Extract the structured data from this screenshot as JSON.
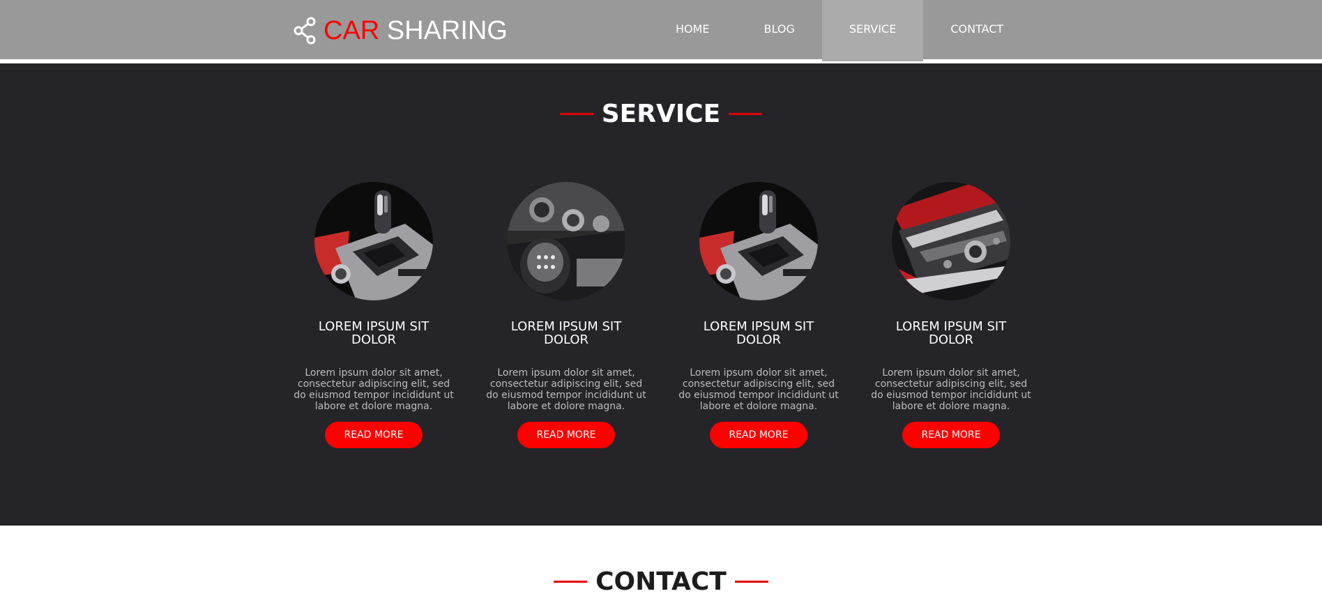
{
  "brand": {
    "logo_icon": "share-icon",
    "word_accent": "CAR",
    "word_main": "SHARING",
    "accent_color": "#ff0000"
  },
  "nav": {
    "items": [
      {
        "label": "HOME"
      },
      {
        "label": "BLOG"
      },
      {
        "label": "SERVICE",
        "active": true
      },
      {
        "label": "CONTACT"
      }
    ]
  },
  "service": {
    "title": "SERVICE",
    "cards": [
      {
        "image": "gear-shift-photo",
        "title": "LOREM IPSUM SIT DOLOR",
        "text": "Lorem ipsum dolor sit amet, consectetur adipiscing elit, sed do eiusmod tempor incididunt ut labore et dolore magna.",
        "button": "READ MORE"
      },
      {
        "image": "manual-gearstick-photo",
        "title": "LOREM IPSUM SIT DOLOR",
        "text": "Lorem ipsum dolor sit amet, consectetur adipiscing elit, sed do eiusmod tempor incididunt ut labore et dolore magna.",
        "button": "READ MORE"
      },
      {
        "image": "gear-shift-photo",
        "title": "LOREM IPSUM SIT DOLOR",
        "text": "Lorem ipsum dolor sit amet, consectetur adipiscing elit, sed do eiusmod tempor incididunt ut labore et dolore magna.",
        "button": "READ MORE"
      },
      {
        "image": "center-console-photo",
        "title": "LOREM IPSUM SIT DOLOR",
        "text": "Lorem ipsum dolor sit amet, consectetur adipiscing elit, sed do eiusmod tempor incididunt ut labore et dolore magna.",
        "button": "READ MORE"
      }
    ]
  },
  "contact": {
    "title": "CONTACT"
  },
  "colors": {
    "header_bg": "#999999",
    "nav_active_bg": "#ababab",
    "section_bg": "#252429",
    "button_bg": "#ff0000"
  }
}
